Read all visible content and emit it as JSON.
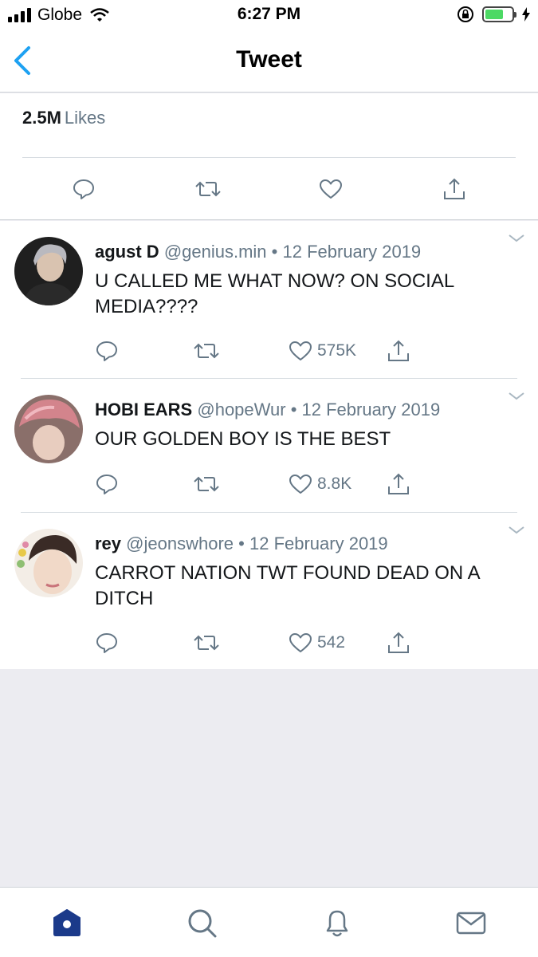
{
  "status_bar": {
    "carrier": "Globe",
    "time": "6:27 PM",
    "battery_level": 0.7
  },
  "nav": {
    "title": "Tweet",
    "back_icon": "chevron-left-icon"
  },
  "likes": {
    "count": "2.5M",
    "label": "Likes"
  },
  "replies": [
    {
      "name": "agust D",
      "handle": "@genius.min",
      "date": "12 February 2019",
      "text": "U CALLED ME WHAT NOW? ON SOCIAL MEDIA????",
      "likes": "575K"
    },
    {
      "name": "HOBI EARS",
      "handle": "@hopeWur",
      "date": "12 February 2019",
      "text": "OUR GOLDEN BOY IS THE BEST",
      "likes": "8.8K"
    },
    {
      "name": "rey",
      "handle": "@jeonswhore",
      "date": "12 February 2019",
      "text": "CARROT NATION TWT FOUND DEAD ON A DITCH",
      "likes": "542"
    }
  ],
  "separator": "•",
  "tabs": [
    "home-icon",
    "search-icon",
    "notifications-icon",
    "messages-icon"
  ],
  "colors": {
    "accent": "#1da1f2",
    "active_tab": "#1b3a8a",
    "icon_gray": "#657786",
    "battery": "#4cd964"
  }
}
